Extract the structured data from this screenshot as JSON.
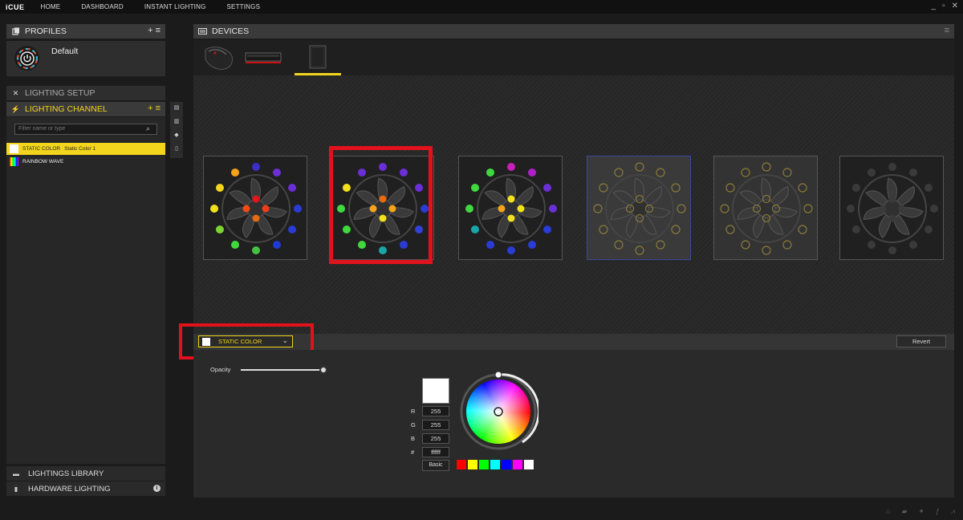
{
  "app": {
    "logo": "iCUE",
    "nav": [
      "HOME",
      "DASHBOARD",
      "INSTANT LIGHTING",
      "SETTINGS"
    ],
    "window_controls": [
      "_",
      "▫",
      "✕"
    ]
  },
  "profiles": {
    "title": "PROFILES",
    "actions": "+ ≡",
    "current": "Default"
  },
  "lighting": {
    "setup_title": "LIGHTING SETUP",
    "channel_title": "LIGHTING CHANNEL",
    "channel_actions": "+ ≡",
    "filter_placeholder": "Filter name or type",
    "items": [
      {
        "type": "STATIC COLOR",
        "name": "Static Color 1"
      },
      {
        "type": "RAINBOW WAVE",
        "name": ""
      }
    ],
    "library": "LIGHTINGS LIBRARY",
    "hardware": "HARDWARE LIGHTING",
    "info": "i"
  },
  "devices": {
    "title": "DEVICES",
    "menu": "≡",
    "tabs": [
      "mouse",
      "memory",
      "fan-hub"
    ],
    "active_tab": 2
  },
  "effect": {
    "selected": "STATIC COLOR",
    "revert_label": "Revert"
  },
  "color": {
    "opacity_label": "Opacity",
    "opacity": 1.0,
    "r_label": "R",
    "g_label": "G",
    "b_label": "B",
    "hex_label": "#",
    "r": "255",
    "g": "255",
    "b": "255",
    "hex": "ffffff",
    "basic_label": "Basic",
    "preview": "#ffffff",
    "palette": [
      "#ff0000",
      "#ffff00",
      "#00ff00",
      "#00ffff",
      "#0000ff",
      "#ff00ff",
      "#ffffff"
    ]
  },
  "accent": "#f2d51c",
  "highlight_color": "#e2121c"
}
